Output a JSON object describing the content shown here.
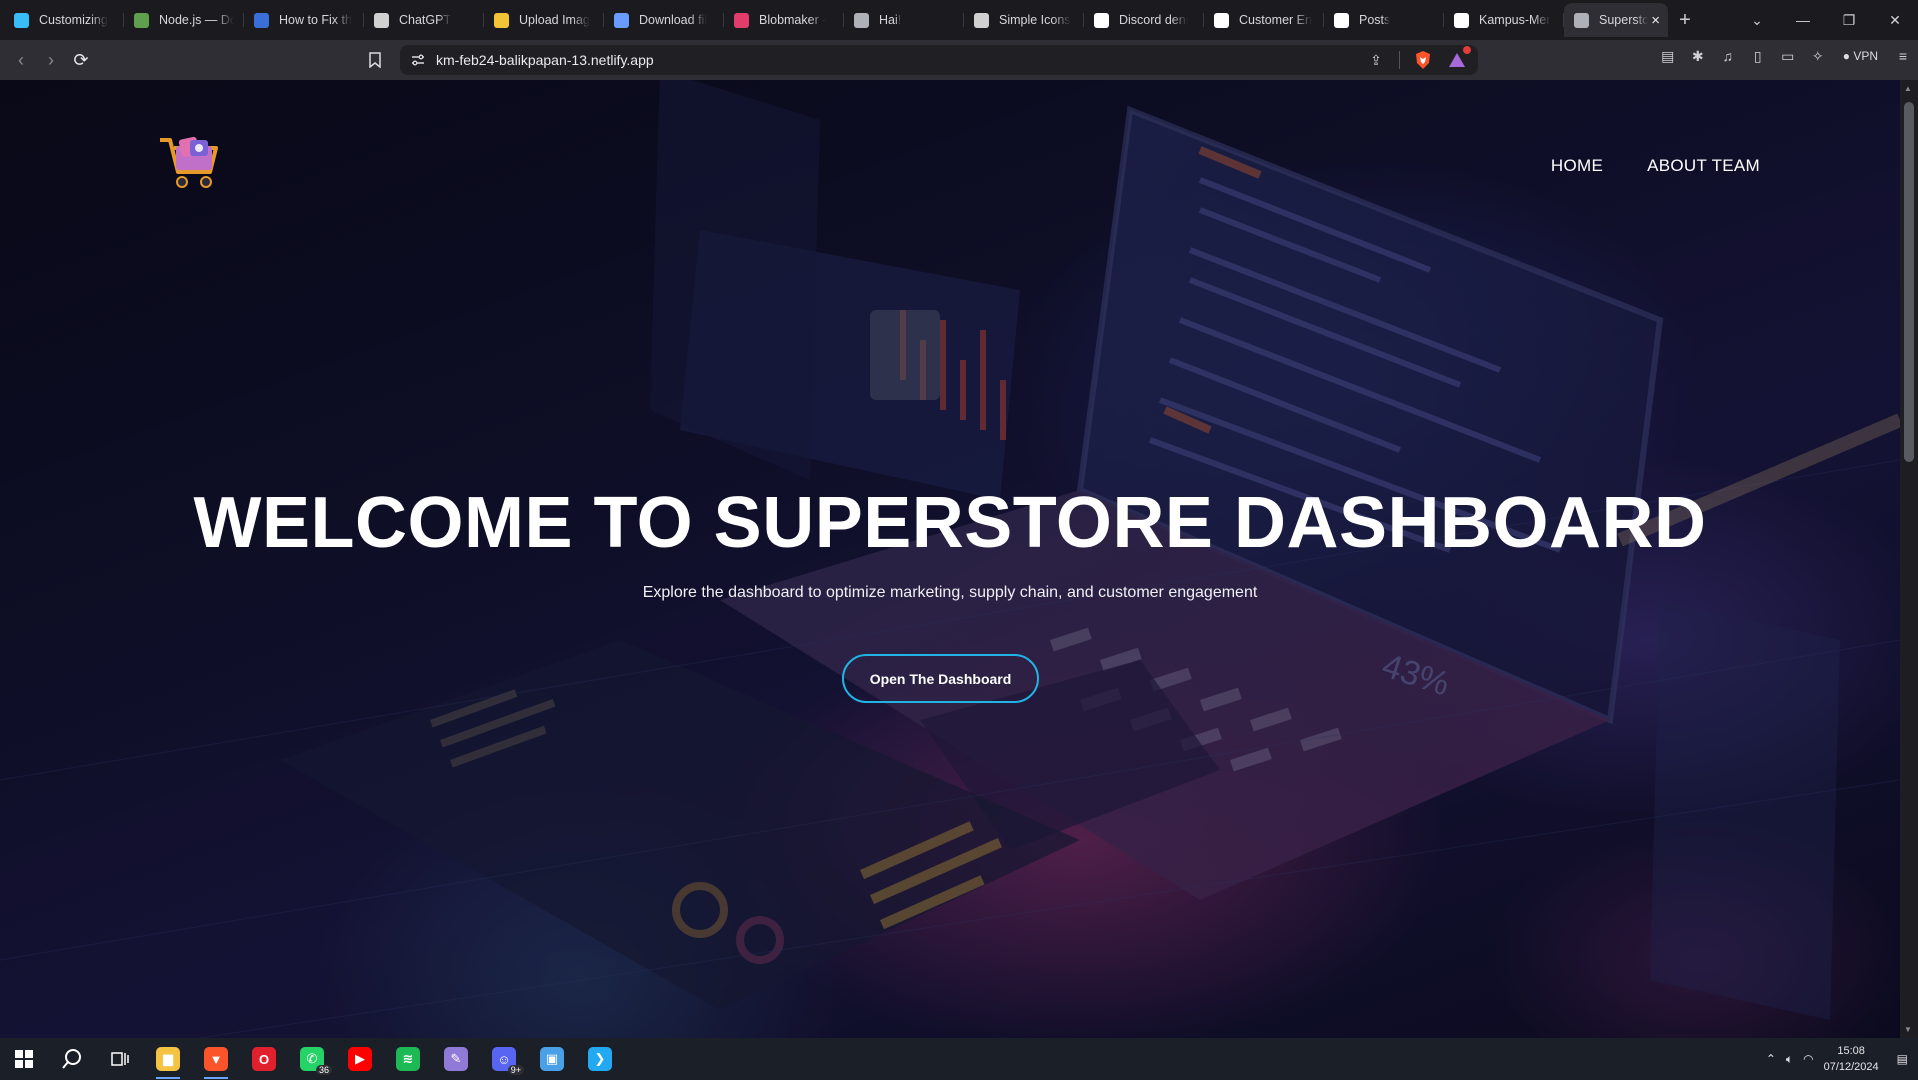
{
  "browser": {
    "tabs": [
      {
        "title": "Customizing",
        "icon": "tailwind-icon",
        "color": "#38bdf8"
      },
      {
        "title": "Node.js — Do",
        "icon": "nodejs-icon",
        "color": "#5fa04e"
      },
      {
        "title": "How to Fix th",
        "icon": "globe-icon",
        "color": "#3b6fd8"
      },
      {
        "title": "ChatGPT",
        "icon": "openai-icon",
        "color": "#d0d0d0"
      },
      {
        "title": "Upload Imag",
        "icon": "imgbb-icon",
        "color": "#f3c338"
      },
      {
        "title": "Download fil",
        "icon": "diamond-icon",
        "color": "#6a9cff"
      },
      {
        "title": "Blobmaker - ",
        "icon": "blob-icon",
        "color": "#e23c6a"
      },
      {
        "title": "Hai!",
        "icon": "globe-icon",
        "color": "#b0b0b8"
      },
      {
        "title": "Simple Icons",
        "icon": "simple-icons-icon",
        "color": "#d0d0d0"
      },
      {
        "title": "Discord deni",
        "icon": "google-icon",
        "color": "#ffffff"
      },
      {
        "title": "Customer En",
        "icon": "notion-icon",
        "color": "#ffffff"
      },
      {
        "title": "Posts",
        "icon": "notion-icon",
        "color": "#ffffff"
      },
      {
        "title": "Kampus-Mer",
        "icon": "github-icon",
        "color": "#ffffff"
      },
      {
        "title": "Superstc",
        "icon": "globe-icon",
        "color": "#b0b0b8",
        "active": true
      }
    ],
    "url": "km-feb24-balikpapan-13.netlify.app",
    "vpn_label": "VPN"
  },
  "page": {
    "nav": {
      "home": "HOME",
      "about": "ABOUT TEAM"
    },
    "hero_title": "WELCOME TO SUPERSTORE DASHBOARD",
    "hero_subtitle": "Explore the dashboard to optimize marketing, supply chain, and customer engagement",
    "cta_label": "Open The Dashboard",
    "bg_stat_text": "43%",
    "accent_color": "#21b3e6"
  },
  "taskbar": {
    "apps": [
      {
        "name": "file-explorer-icon",
        "color": "#f5c342",
        "glyph": "▆",
        "open": true
      },
      {
        "name": "brave-icon",
        "color": "#fb542b",
        "glyph": "▼",
        "open": true
      },
      {
        "name": "opera-icon",
        "color": "#e0202c",
        "glyph": "O",
        "open": false
      },
      {
        "name": "whatsapp-icon",
        "color": "#25d366",
        "glyph": "✆",
        "open": false,
        "badge": "36"
      },
      {
        "name": "youtube-icon",
        "color": "#ff0000",
        "glyph": "▶",
        "open": false
      },
      {
        "name": "spotify-icon",
        "color": "#1db954",
        "glyph": "≋",
        "open": false
      },
      {
        "name": "paint-icon",
        "color": "#8f7ad8",
        "glyph": "✎",
        "open": false
      },
      {
        "name": "discord-icon",
        "color": "#5865f2",
        "glyph": "☺",
        "open": false,
        "badge": "9+"
      },
      {
        "name": "control-panel-icon",
        "color": "#4aa0e6",
        "glyph": "▣",
        "open": false
      },
      {
        "name": "vscode-icon",
        "color": "#23a9f2",
        "glyph": "❯",
        "open": false
      }
    ],
    "time": "15:08",
    "date": "07/12/2024"
  }
}
